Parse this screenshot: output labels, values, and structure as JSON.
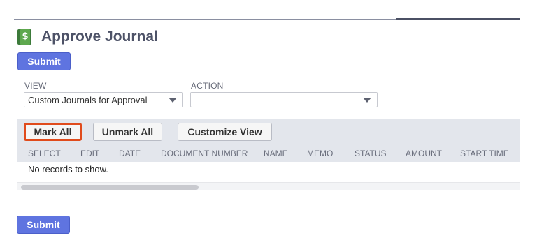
{
  "page": {
    "title": "Approve Journal",
    "icon": "ledger-dollar-icon"
  },
  "buttons": {
    "submit_top": "Submit",
    "submit_bottom": "Submit"
  },
  "filters": {
    "view_label": "VIEW",
    "view_value": "Custom Journals for Approval",
    "action_label": "ACTION",
    "action_value": ""
  },
  "list": {
    "mark_all": "Mark All",
    "unmark_all": "Unmark All",
    "customize_view": "Customize View",
    "columns": [
      "SELECT",
      "EDIT",
      "DATE",
      "DOCUMENT NUMBER",
      "NAME",
      "MEMO",
      "STATUS",
      "AMOUNT",
      "START TIME"
    ],
    "empty_message": "No records to show."
  },
  "colors": {
    "primary_button": "#5f74e0",
    "highlight_border": "#e04b1c",
    "title_text": "#4d5267",
    "list_header_bg": "#e3e6ec"
  }
}
